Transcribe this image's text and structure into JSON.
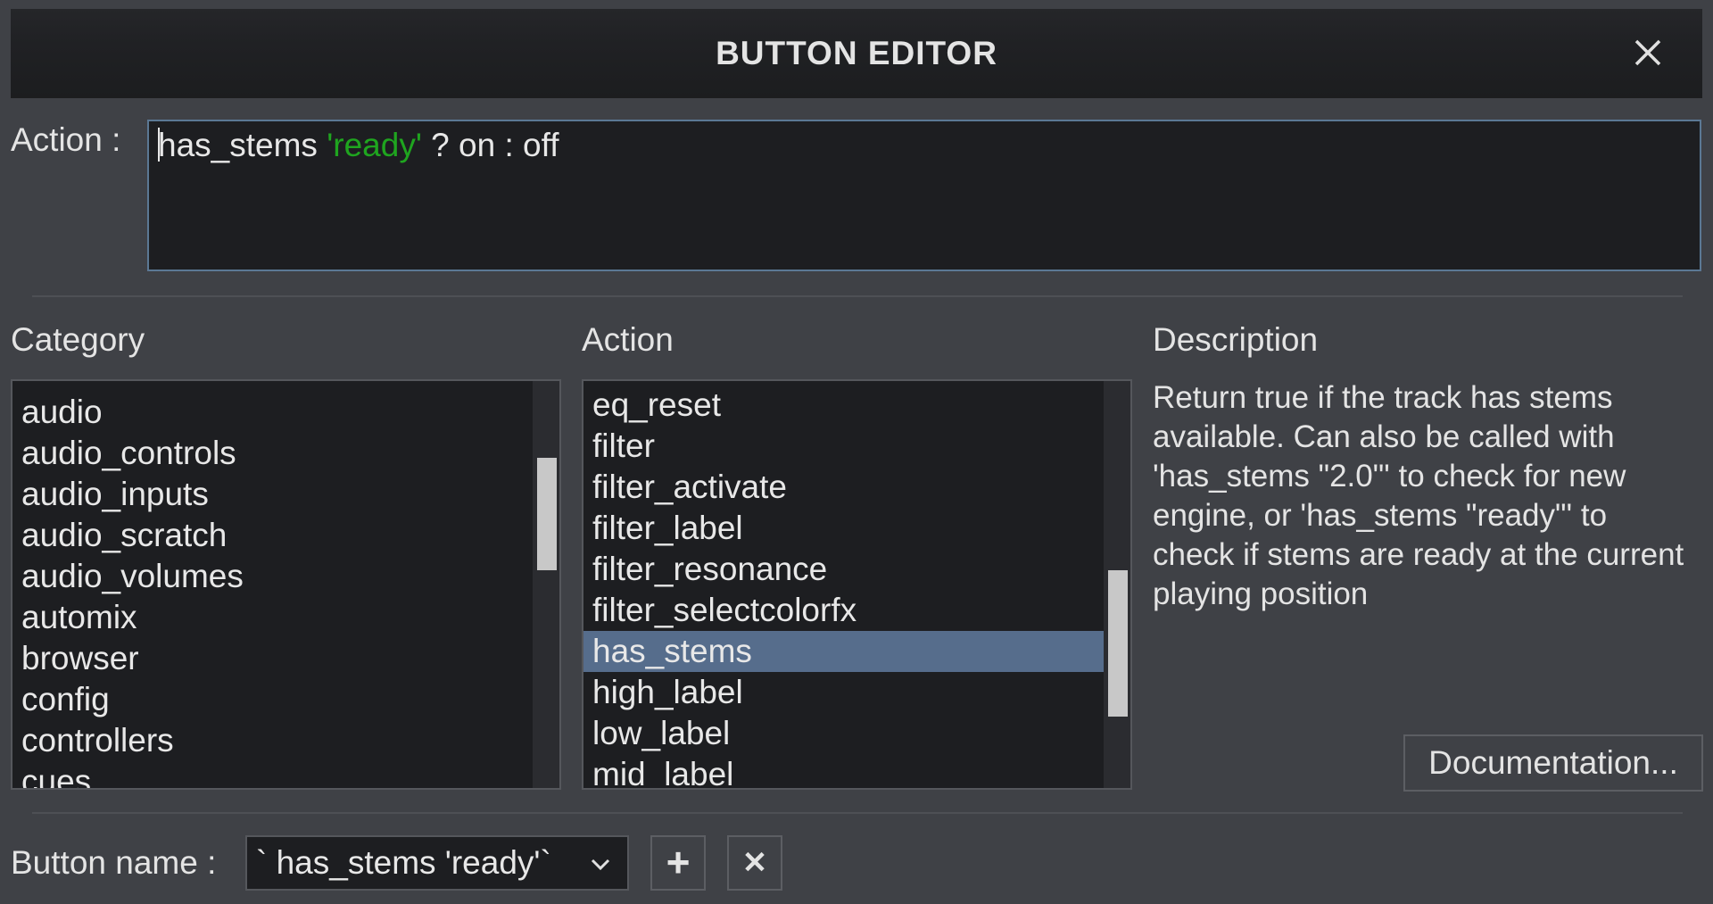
{
  "dialog": {
    "title": "BUTTON EDITOR"
  },
  "action_field": {
    "label": "Action :",
    "code_parts": {
      "keyword": "has_stems ",
      "string": "'ready'",
      "rest": " ? on : off"
    }
  },
  "columns": {
    "category_header": "Category",
    "action_header": "Action",
    "description_header": "Description"
  },
  "category_list": {
    "items": [
      "audio",
      "audio_controls",
      "audio_inputs",
      "audio_scratch",
      "audio_volumes",
      "automix",
      "browser",
      "config",
      "controllers",
      "cues"
    ]
  },
  "action_list": {
    "items": [
      "eq_reset",
      "filter",
      "filter_activate",
      "filter_label",
      "filter_resonance",
      "filter_selectcolorfx",
      "has_stems",
      "high_label",
      "low_label",
      "mid_label"
    ],
    "selected": "has_stems"
  },
  "description": {
    "text": "Return true if the track has stems available. Can also be called with 'has_stems \"2.0\"' to check for new engine, or 'has_stems \"ready\"' to check if stems are ready at the current playing position"
  },
  "buttons": {
    "documentation": "Documentation...",
    "add": "+",
    "remove": "✕"
  },
  "button_name": {
    "label": "Button name :",
    "value": "` has_stems 'ready'`"
  }
}
